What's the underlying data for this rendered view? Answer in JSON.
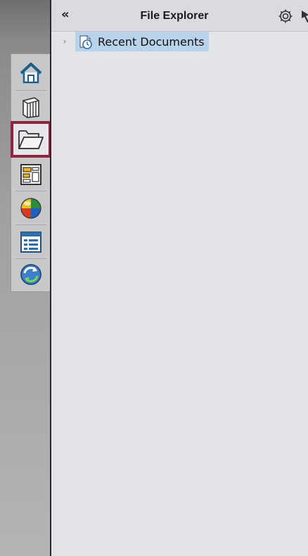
{
  "panel": {
    "collapse_label": "«",
    "title": "File Explorer"
  },
  "tree": {
    "items": [
      {
        "label": "Recent Documents",
        "expander": "›",
        "icon": "recent-documents-icon"
      }
    ]
  },
  "tabs": [
    {
      "name": "home",
      "icon": "home-icon",
      "selected": false
    },
    {
      "name": "library",
      "icon": "library-icon",
      "selected": false
    },
    {
      "name": "file-explorer",
      "icon": "folder-open-icon",
      "selected": true
    },
    {
      "name": "design-library",
      "icon": "design-library-icon",
      "selected": false
    },
    {
      "name": "appearances",
      "icon": "appearances-icon",
      "selected": false
    },
    {
      "name": "custom-properties",
      "icon": "custom-properties-icon",
      "selected": false
    },
    {
      "name": "refresh",
      "icon": "refresh-icon",
      "selected": false
    }
  ],
  "colors": {
    "selected_border": "#9c1f3f",
    "selection_bg": "#b9d3ea"
  }
}
